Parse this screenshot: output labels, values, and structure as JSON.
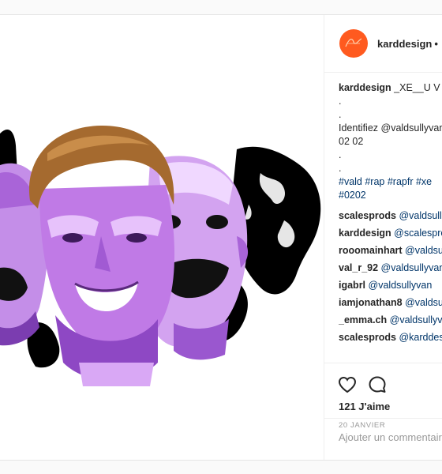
{
  "post": {
    "username": "karddesign",
    "separator": "•",
    "avatar_color": "#ff5a1f",
    "caption": {
      "author": "karddesign",
      "text": "_XE__U V",
      "lines": [
        ".",
        ".",
        "Identifiez @valdsullyvan",
        "02 02",
        ".",
        "."
      ],
      "hashtags": [
        "#vald #rap #rapfr #xe",
        "#0202"
      ]
    },
    "comments": [
      {
        "user": "scalesprods",
        "text": "@valdsullyvan"
      },
      {
        "user": "karddesign",
        "text": "@scalesprods"
      },
      {
        "user": "rooomainhart",
        "text": "@valdsullyvan"
      },
      {
        "user": "val_r_92",
        "text": "@valdsullyvan"
      },
      {
        "user": "igabrl",
        "text": "@valdsullyvan"
      },
      {
        "user": "iamjonathan8",
        "text": "@valdsullyvan"
      },
      {
        "user": "_emma.ch",
        "text": "@valdsullyvan"
      },
      {
        "user": "scalesprods",
        "text": "@karddesign"
      }
    ],
    "likes": "121 J'aime",
    "date": "20 JANVIER",
    "comment_placeholder": "Ajouter un commentaire...",
    "icons": {
      "like": "heart-icon",
      "comment": "comment-bubble-icon"
    }
  }
}
